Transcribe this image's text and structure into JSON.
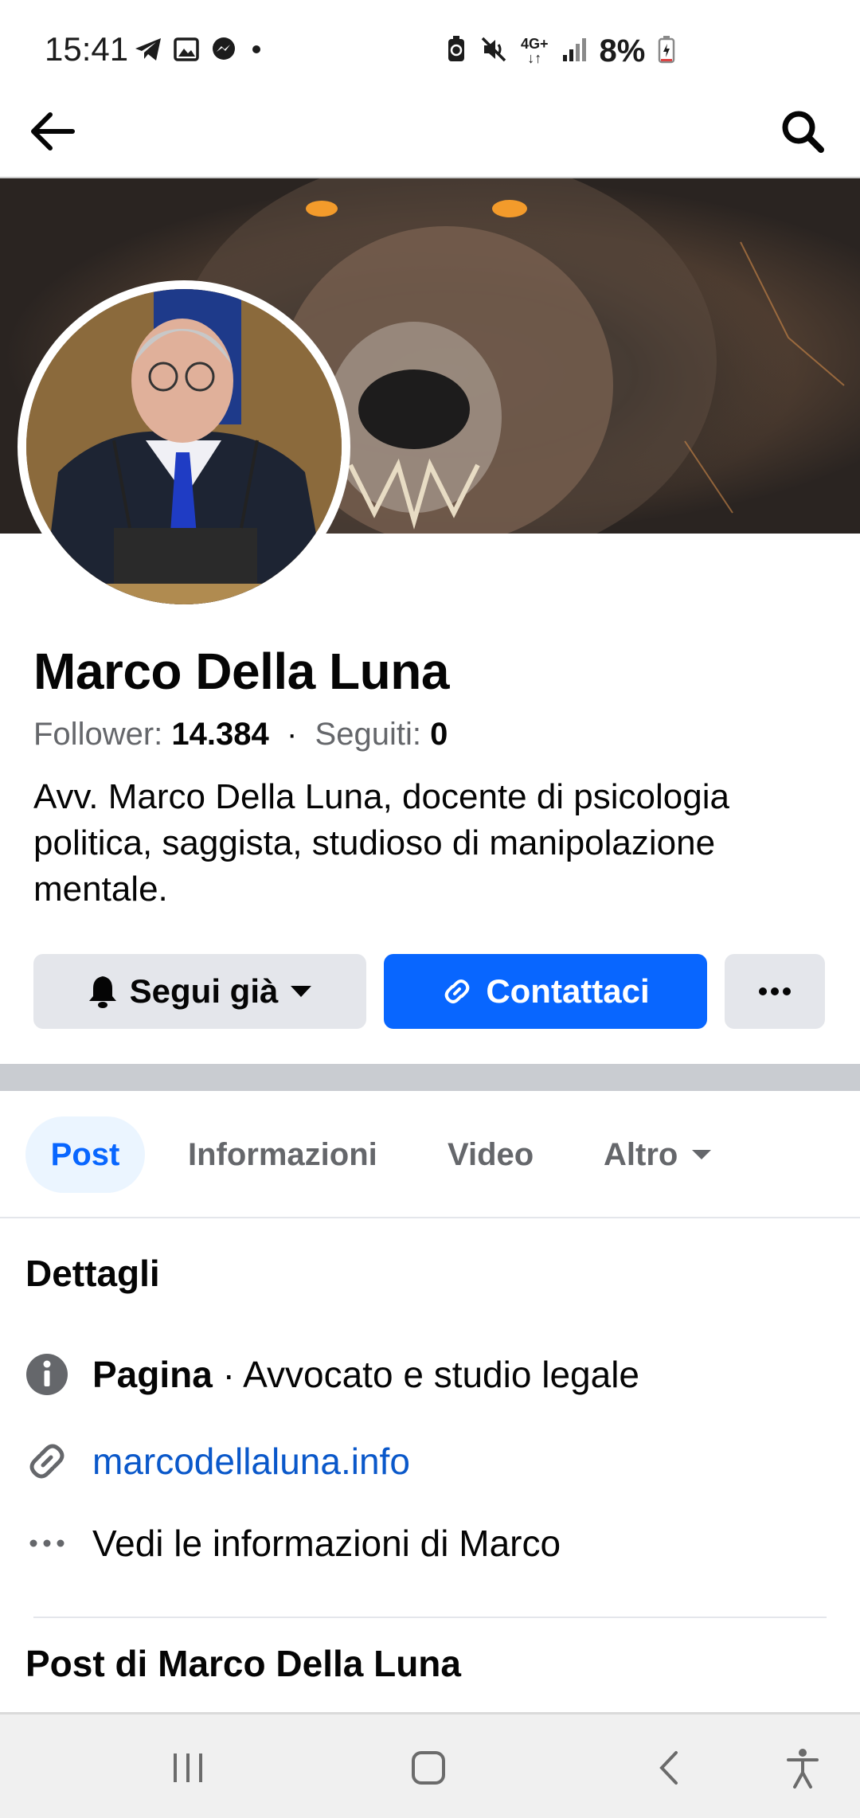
{
  "status_bar": {
    "time": "15:41",
    "network": "4G+",
    "battery": "8%",
    "icons_left": [
      "telegram-icon",
      "gallery-icon",
      "messenger-icon",
      "dot-icon"
    ],
    "icons_right": [
      "battery-saver-icon",
      "mute-icon",
      "network-icon",
      "signal-icon",
      "battery-icon"
    ]
  },
  "profile": {
    "name": "Marco Della Luna",
    "followers_label": "Follower:",
    "followers_count": "14.384",
    "separator": "·",
    "following_label": "Seguiti:",
    "following_count": "0",
    "bio": "Avv. Marco Della Luna, docente di psicologia politica, saggista, studioso di manipolazione mentale."
  },
  "actions": {
    "follow_label": "Segui già",
    "contact_label": "Contattaci",
    "more_label": "···"
  },
  "tabs": [
    {
      "label": "Post",
      "active": true
    },
    {
      "label": "Informazioni",
      "active": false
    },
    {
      "label": "Video",
      "active": false
    },
    {
      "label": "Altro",
      "active": false
    }
  ],
  "details": {
    "title": "Dettagli",
    "page_label": "Pagina",
    "page_category": " · Avvocato e studio legale",
    "website": "marcodellaluna.info",
    "see_info": "Vedi le informazioni di Marco"
  },
  "posts_section": {
    "title": "Post di Marco Della Luna"
  },
  "colors": {
    "accent": "#0866ff",
    "link": "#0a58ca",
    "secondary_text": "#65676b",
    "button_gray": "#e4e6eb"
  }
}
